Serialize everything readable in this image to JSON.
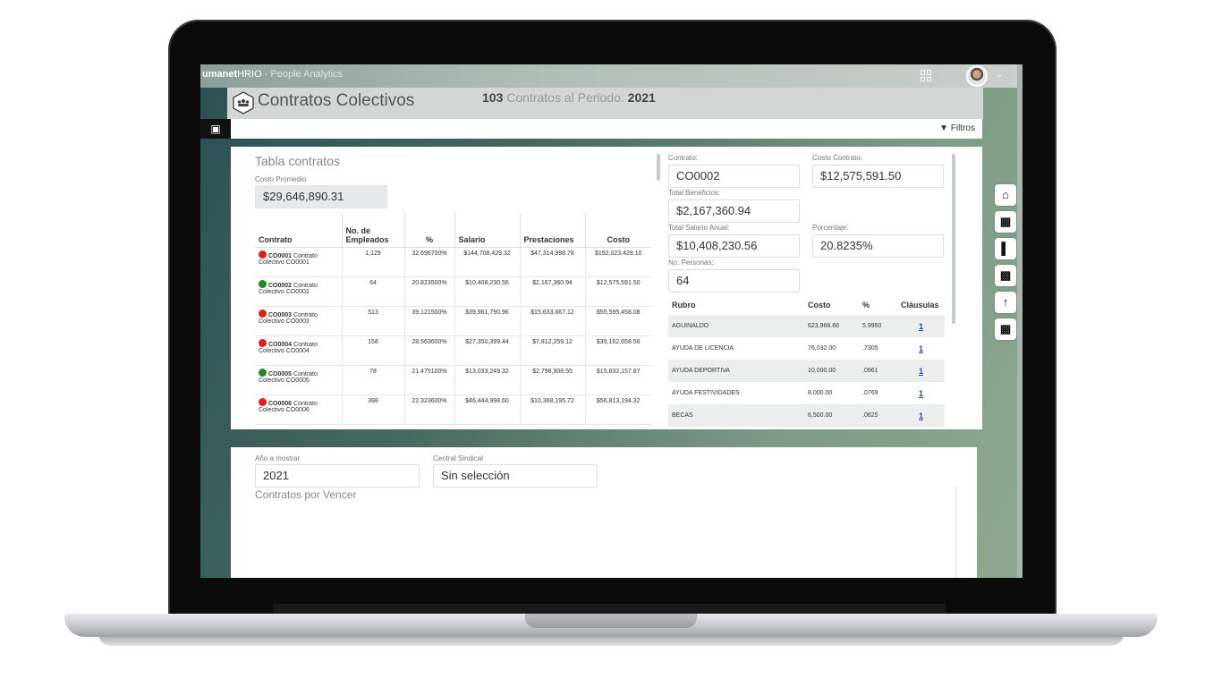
{
  "app": {
    "brand_bold": "umanet",
    "brand_rest": "HRIO",
    "brand_sub": " - People Analytics"
  },
  "header": {
    "title": "Contratos Colectivos",
    "count": "103",
    "period_label": " Contratos al Periodo: ",
    "period_year": "2021"
  },
  "toolbar": {
    "export_icon": "export-icon",
    "filters_label": "Filtros"
  },
  "table_section": {
    "title": "Tabla contratos",
    "avg_label": "Costo Promedio",
    "avg_value": "$29,646,890.31",
    "columns": [
      "Contrato",
      "No. de Empleados",
      "%",
      "Salario",
      "Prestaciones",
      "Costo"
    ],
    "rows": [
      {
        "status": "red",
        "code": "CO0001",
        "name": "Contrato",
        "name2": "Colectivo CO0001",
        "emp": "1,129",
        "pct": "32.696700%",
        "sal": "$144,708,429.32",
        "pres": "$47,314,998.78",
        "cost": "$192,023,428.10"
      },
      {
        "status": "green",
        "code": "CO0002",
        "name": "Contrato",
        "name2": "Colectivo CO0002",
        "emp": "64",
        "pct": "20.823500%",
        "sal": "$10,408,230.56",
        "pres": "$2,167,360.94",
        "cost": "$12,575,591.50"
      },
      {
        "status": "red",
        "code": "CO0003",
        "name": "Contrato",
        "name2": "Colectivo CO0003",
        "emp": "513",
        "pct": "39.121500%",
        "sal": "$39,961,790.96",
        "pres": "$15,633,667.12",
        "cost": "$55,595,458.08"
      },
      {
        "status": "red",
        "code": "CO0004",
        "name": "Contrato",
        "name2": "Colectivo CO0004",
        "emp": "158",
        "pct": "28.563600%",
        "sal": "$27,350,399.44",
        "pres": "$7,812,259.12",
        "cost": "$35,162,658.56"
      },
      {
        "status": "green",
        "code": "CO0005",
        "name": "Contrato",
        "name2": "Colectivo CO0005",
        "emp": "78",
        "pct": "21.475100%",
        "sal": "$13,033,249.32",
        "pres": "$2,798,908.55",
        "cost": "$15,832,157.87"
      },
      {
        "status": "red",
        "code": "CO0006",
        "name": "Contrato",
        "name2": "Colectivo CO0006",
        "emp": "398",
        "pct": "22.323600%",
        "sal": "$46,444,998.60",
        "pres": "$10,368,195.72",
        "cost": "$56,813,194.32"
      }
    ]
  },
  "detail": {
    "contrato_label": "Contrato:",
    "contrato_value": "CO0002",
    "costo_label": "Costo Contrato:",
    "costo_value": "$12,575,591.50",
    "beneficios_label": "Total Beneficios:",
    "beneficios_value": "$2,167,360.94",
    "salario_label": "Total Salario Anual:",
    "salario_value": "$10,408,230.56",
    "porcentaje_label": "Porcentaje:",
    "porcentaje_value": "20.8235%",
    "personas_label": "No. Personas:",
    "personas_value": "64",
    "rubro_columns": [
      "Rubro",
      "Costo",
      "%",
      "Cláusulas"
    ],
    "rubros": [
      {
        "name": "AGUINALDO",
        "cost": "623,968.66",
        "pct": "5.9950",
        "cl": "1"
      },
      {
        "name": "AYUDA DE LICENCIA",
        "cost": "76,032.00",
        "pct": ".7305",
        "cl": "1"
      },
      {
        "name": "AYUDA DEPORTIVA",
        "cost": "10,000.00",
        "pct": ".0961",
        "cl": "1"
      },
      {
        "name": "AYUDA FESTIVIDADES",
        "cost": "8,000.00",
        "pct": ".0769",
        "cl": "1"
      },
      {
        "name": "BECAS",
        "cost": "6,500.00",
        "pct": ".0625",
        "cl": "1"
      }
    ]
  },
  "bottom": {
    "year_label": "Año a mostrar",
    "year_value": "2021",
    "central_label": "Central Sindical",
    "central_value": "Sin selección",
    "expiring_title": "Contratos por Vencer"
  },
  "rightnav": [
    "home-icon",
    "table-icon",
    "bar-chart-icon",
    "id-card-icon",
    "upload-icon",
    "table-icon"
  ]
}
